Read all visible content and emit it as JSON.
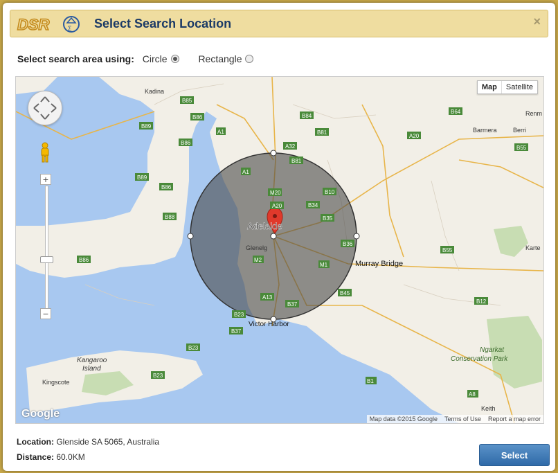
{
  "header": {
    "logo_text": "DSR",
    "title": "Select Search Location",
    "close_label": "×"
  },
  "search_mode": {
    "label": "Select search area using:",
    "options": [
      {
        "label": "Circle",
        "selected": true
      },
      {
        "label": "Rectangle",
        "selected": false
      }
    ]
  },
  "map": {
    "map_type": [
      "Map",
      "Satellite"
    ],
    "active_type": "Map",
    "circle": {
      "center": "Adelaide",
      "radius_km": 60.0
    },
    "places": [
      "Kadina",
      "Adelaide",
      "Glenelg",
      "Murray Bridge",
      "Victor Harbor",
      "Kangaroo Island",
      "Kingscote",
      "Barmera",
      "Berri",
      "Renm",
      "Karte",
      "Keith",
      "Ngarkat Conservation Park"
    ],
    "roads": [
      "B85",
      "B86",
      "B89",
      "A1",
      "B84",
      "B81",
      "B64",
      "A20",
      "B55",
      "B88",
      "A32",
      "B10",
      "B34",
      "M20",
      "B35",
      "B36",
      "M2",
      "M1",
      "A13",
      "B37",
      "B45",
      "B23",
      "B12",
      "B1",
      "A8",
      "A66"
    ],
    "attribution": {
      "logo": "Google",
      "data": "Map data ©2015 Google",
      "terms": "Terms of Use",
      "report": "Report a map error"
    },
    "colors": {
      "water": "#a8c8f0",
      "land": "#f2efe7",
      "circle_fill": "#555555",
      "marker": "#e0392b"
    }
  },
  "details": {
    "location_label": "Location:",
    "location_value": "Glenside SA 5065, Australia",
    "distance_label": "Distance:",
    "distance_value": "60.0KM"
  },
  "actions": {
    "select_label": "Select"
  }
}
